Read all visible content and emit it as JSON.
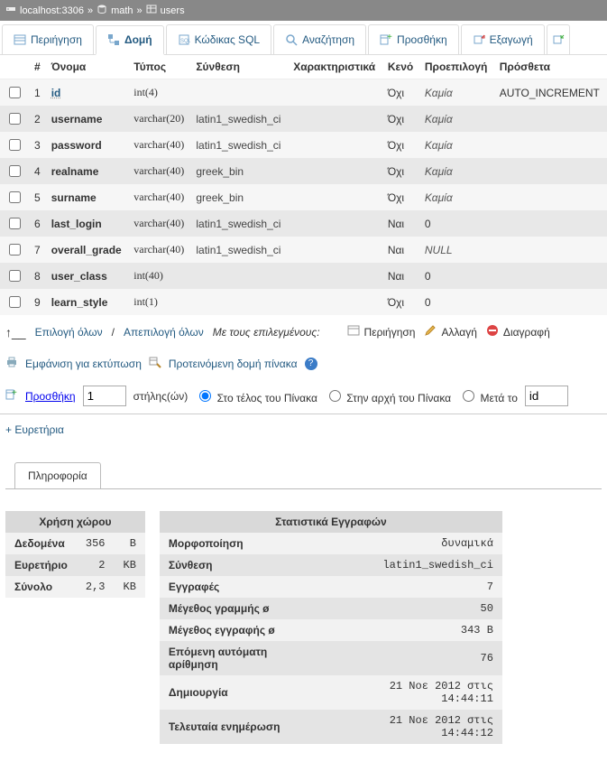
{
  "breadcrumb": {
    "server": "localhost:3306",
    "db": "math",
    "table": "users"
  },
  "tabs": {
    "browse": "Περιήγηση",
    "structure": "Δομή",
    "sql": "Κώδικας SQL",
    "search": "Αναζήτηση",
    "insert": "Προσθήκη",
    "export": "Εξαγωγή"
  },
  "cols": {
    "num": "#",
    "name": "Όνομα",
    "type": "Τύπος",
    "collation": "Σύνθεση",
    "attributes": "Χαρακτηριστικά",
    "null": "Κενό",
    "default": "Προεπιλογή",
    "extra": "Πρόσθετα"
  },
  "rows": [
    {
      "n": "1",
      "name": "id",
      "pk": true,
      "type": "int(4)",
      "coll": "",
      "null": "Όχι",
      "def": "Καμία",
      "def_italic": true,
      "extra": "AUTO_INCREMENT"
    },
    {
      "n": "2",
      "name": "username",
      "pk": false,
      "type": "varchar(20)",
      "coll": "latin1_swedish_ci",
      "null": "Όχι",
      "def": "Καμία",
      "def_italic": true,
      "extra": ""
    },
    {
      "n": "3",
      "name": "password",
      "pk": false,
      "type": "varchar(40)",
      "coll": "latin1_swedish_ci",
      "null": "Όχι",
      "def": "Καμία",
      "def_italic": true,
      "extra": ""
    },
    {
      "n": "4",
      "name": "realname",
      "pk": false,
      "type": "varchar(40)",
      "coll": "greek_bin",
      "null": "Όχι",
      "def": "Καμία",
      "def_italic": true,
      "extra": ""
    },
    {
      "n": "5",
      "name": "surname",
      "pk": false,
      "type": "varchar(40)",
      "coll": "greek_bin",
      "null": "Όχι",
      "def": "Καμία",
      "def_italic": true,
      "extra": ""
    },
    {
      "n": "6",
      "name": "last_login",
      "pk": false,
      "type": "varchar(40)",
      "coll": "latin1_swedish_ci",
      "null": "Ναι",
      "def": "0",
      "def_italic": false,
      "extra": ""
    },
    {
      "n": "7",
      "name": "overall_grade",
      "pk": false,
      "type": "varchar(40)",
      "coll": "latin1_swedish_ci",
      "null": "Ναι",
      "def": "NULL",
      "def_italic": true,
      "extra": ""
    },
    {
      "n": "8",
      "name": "user_class",
      "pk": false,
      "type": "int(40)",
      "coll": "",
      "null": "Ναι",
      "def": "0",
      "def_italic": false,
      "extra": ""
    },
    {
      "n": "9",
      "name": "learn_style",
      "pk": false,
      "type": "int(1)",
      "coll": "",
      "null": "Όχι",
      "def": "0",
      "def_italic": false,
      "extra": ""
    }
  ],
  "bulk": {
    "check_all": "Επιλογή όλων",
    "uncheck_all": "Απεπιλογή όλων",
    "with_selected": "Με τους επιλεγμένους:",
    "browse": "Περιήγηση",
    "change": "Αλλαγή",
    "drop": "Διαγραφή"
  },
  "tools": {
    "print": "Εμφάνιση για εκτύπωση",
    "propose": "Προτεινόμενη δομή πίνακα"
  },
  "add": {
    "label": "Προσθήκη",
    "count": "1",
    "cols_word": "στήλης(ών)",
    "at_end": "Στο τέλος του Πίνακα",
    "at_start": "Στην αρχή του Πίνακα",
    "after": "Μετά το",
    "after_field": "id"
  },
  "indexes_link": "+ Ευρετήρια",
  "info": {
    "tab": "Πληροφορία",
    "space": {
      "title": "Χρήση χώρου",
      "data_label": "Δεδομένα",
      "data_val": "356",
      "data_unit": "B",
      "index_label": "Ευρετήριο",
      "index_val": "2",
      "index_unit": "KB",
      "total_label": "Σύνολο",
      "total_val": "2,3",
      "total_unit": "KB"
    },
    "stats": {
      "title": "Στατιστικά Εγγραφών",
      "format_l": "Μορφοποίηση",
      "format_v": "δυναμικά",
      "coll_l": "Σύνθεση",
      "coll_v": "latin1_swedish_ci",
      "rows_l": "Εγγραφές",
      "rows_v": "7",
      "rowlen_l": "Μέγεθος γραμμής ø",
      "rowlen_v": "50",
      "recsize_l": "Μέγεθος εγγραφής ø",
      "recsize_v": "343 B",
      "nextauto_l": "Επόμενη αυτόματη αρίθμηση",
      "nextauto_v": "76",
      "created_l": "Δημιουργία",
      "created_v": "21 Νοε 2012 στις 14:44:11",
      "updated_l": "Τελευταία ενημέρωση",
      "updated_v": "21 Νοε 2012 στις 14:44:12"
    }
  }
}
